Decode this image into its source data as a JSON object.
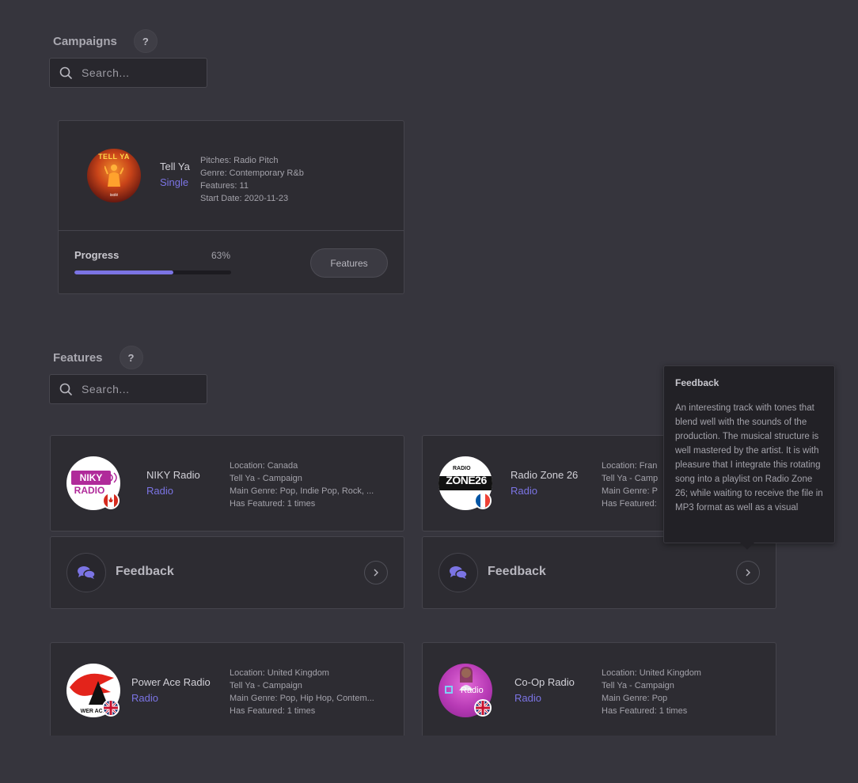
{
  "campaigns": {
    "title": "Campaigns",
    "help": "?",
    "search_placeholder": "Search...",
    "card": {
      "cover_title": "TELL YA",
      "cover_artist": "isolé",
      "name": "Tell Ya",
      "type": "Single",
      "pitches": "Pitches: Radio Pitch",
      "genre": "Genre: Contemporary R&b",
      "features": "Features: 11",
      "start_date": "Start Date: 2020-11-23",
      "progress_label": "Progress",
      "progress_pct": "63%",
      "progress_value": 0.63,
      "features_button": "Features"
    }
  },
  "features": {
    "title": "Features",
    "help": "?",
    "search_placeholder": "Search...",
    "stations": [
      {
        "logo_text": "NIKY",
        "logo_subtext": "RADIO",
        "name": "NIKY Radio",
        "type": "Radio",
        "location": "Location: Canada",
        "campaign": "Tell Ya - Campaign",
        "genre": "Main Genre: Pop, Indie Pop, Rock, ...",
        "featured": "Has Featured: 1 times",
        "flag": "canada-flag"
      },
      {
        "logo_text": "ZONE26",
        "logo_subtext": "RADIO",
        "name": "Radio Zone 26",
        "type": "Radio",
        "location": "Location: Fran",
        "campaign": "Tell Ya - Camp",
        "genre": "Main Genre: P",
        "featured": "Has Featured:",
        "flag": "france-flag"
      },
      {
        "logo_text": "WER ACE",
        "name": "Power Ace Radio",
        "type": "Radio",
        "location": "Location: United Kingdom",
        "campaign": "Tell Ya - Campaign",
        "genre": "Main Genre: Pop, Hip Hop, Contem...",
        "featured": "Has Featured: 1 times",
        "flag": "uk-flag"
      },
      {
        "logo_text": "Radio",
        "name": "Co-Op Radio",
        "type": "Radio",
        "location": "Location: United Kingdom",
        "campaign": "Tell Ya - Campaign",
        "genre": "Main Genre: Pop",
        "featured": "Has Featured: 1 times",
        "flag": "uk-flag"
      }
    ],
    "feedback_label": "Feedback",
    "tooltip": {
      "title": "Feedback",
      "body": "An interesting track with tones that blend well with the sounds of the production. The musical structure is well mastered by the artist. It is with pleasure that I integrate this rotating song into a playlist on Radio Zone 26; while waiting to receive the file in MP3 format as well as a visual"
    }
  },
  "colors": {
    "background": "#36353d",
    "card": "#2d2c32",
    "accent": "#7b74e4",
    "tooltip": "#222126"
  }
}
